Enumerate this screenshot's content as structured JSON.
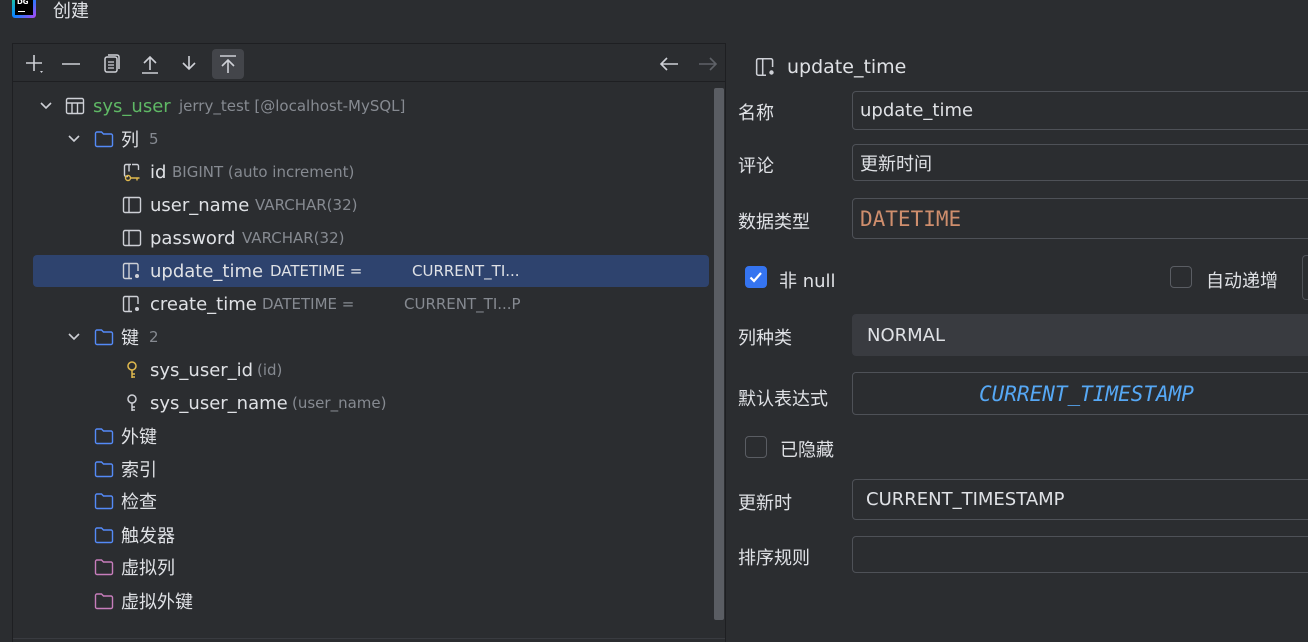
{
  "window": {
    "title": "创建",
    "logo_text": "DG"
  },
  "toolbar": {
    "icons": [
      "add-icon",
      "remove-icon",
      "duplicate-icon",
      "move-up-icon",
      "move-down-icon",
      "move-top-icon",
      "back-arrow-icon",
      "forward-arrow-icon"
    ]
  },
  "tree": {
    "table": {
      "name": "sys_user",
      "hint": "jerry_test [@localhost-MySQL]"
    },
    "columns_folder": {
      "label": "列",
      "count": "5"
    },
    "columns": [
      {
        "name": "id",
        "hint": "BIGINT (auto increment)"
      },
      {
        "name": "user_name",
        "hint": "VARCHAR(32)"
      },
      {
        "name": "password",
        "hint": "VARCHAR(32)"
      },
      {
        "name": "update_time",
        "hint": "DATETIME =",
        "default": "CURRENT_TI..."
      },
      {
        "name": "create_time",
        "hint": "DATETIME =",
        "default": "CURRENT_TI...P"
      }
    ],
    "keys_folder": {
      "label": "键",
      "count": "2"
    },
    "keys": [
      {
        "name": "sys_user_id",
        "hint": "(id)"
      },
      {
        "name": "sys_user_name",
        "hint": "(user_name)"
      }
    ],
    "folders": [
      "外键",
      "索引",
      "检查",
      "触发器",
      "虚拟列",
      "虚拟外键"
    ]
  },
  "properties": {
    "header": "update_time",
    "name_label": "名称",
    "name_value": "update_time",
    "comment_label": "评论",
    "comment_value": "更新时间",
    "type_label": "数据类型",
    "type_value": "DATETIME",
    "not_null_label": "非 null",
    "not_null_checked": true,
    "auto_inc_label": "自动递增",
    "auto_inc_checked": false,
    "kind_label": "列种类",
    "kind_value": "NORMAL",
    "default_label": "默认表达式",
    "default_value": "CURRENT_TIMESTAMP",
    "hidden_label": "已隐藏",
    "hidden_checked": false,
    "on_update_label": "更新时",
    "on_update_value": "CURRENT_TIMESTAMP",
    "collation_label": "排序规则",
    "collation_value": ""
  },
  "colors": {
    "background": "#2b2d30",
    "selection": "#2e436e",
    "table_name": "#5fb865",
    "folder_blue": "#548af7",
    "folder_purple": "#c77dbb",
    "type_value": "#cf8e6d",
    "expression": "#56a8f5",
    "key_gold": "#e0b94e",
    "checkbox_accent": "#3574f0"
  }
}
